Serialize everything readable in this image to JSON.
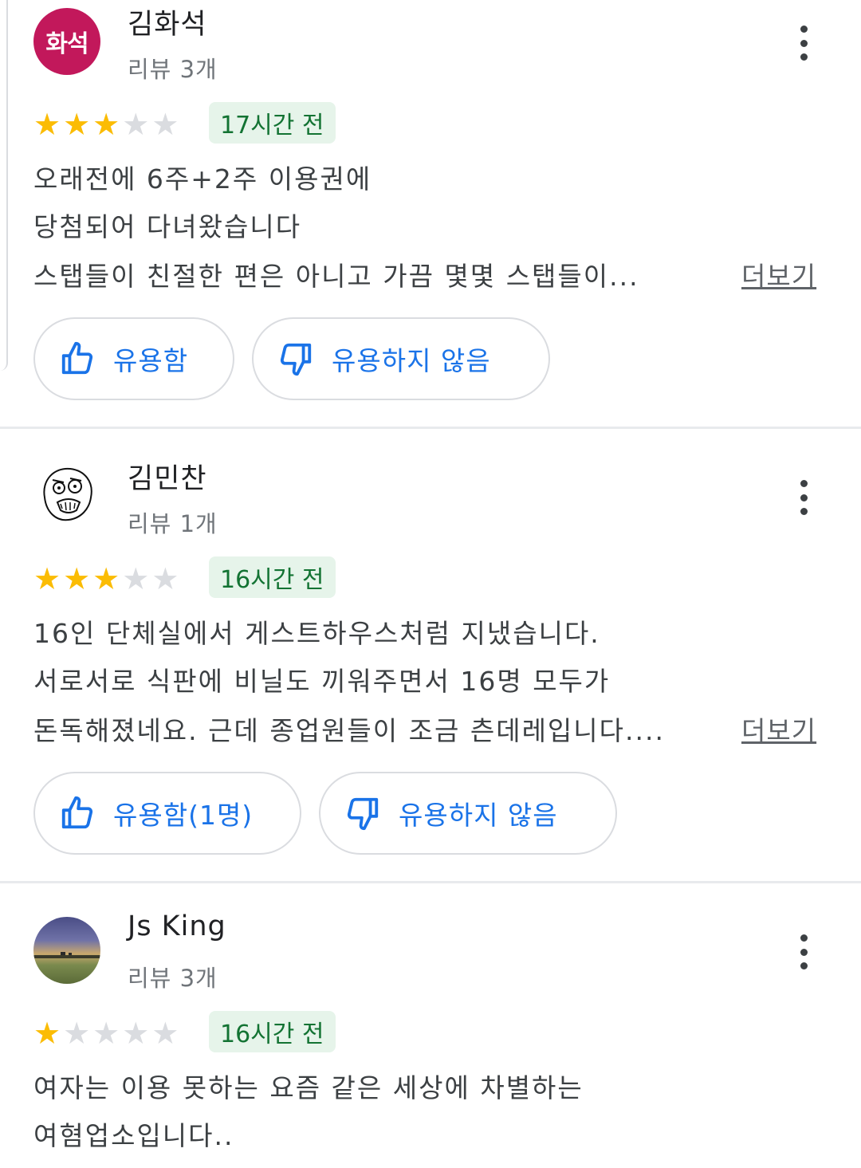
{
  "reviews": [
    {
      "avatar_text": "화석",
      "avatar_color": "#c2185b",
      "name": "김화석",
      "review_count": "리뷰 3개",
      "rating": 3,
      "time": "17시간 전",
      "lines": [
        "오래전에 6주+2주  이용권에",
        "당첨되어 다녀왔습니다",
        "스탭들이 친절한 편은 아니고 가끔 몇몇  스탭들이..."
      ],
      "more_label": "더보기",
      "helpful_label": "유용함",
      "not_helpful_label": "유용하지 않음"
    },
    {
      "avatar_icon": "rage-face-avatar",
      "name": "김민찬",
      "review_count": "리뷰 1개",
      "rating": 3,
      "time": "16시간 전",
      "lines": [
        "16인 단체실에서 게스트하우스처럼 지냈습니다.",
        "서로서로 식판에 비닐도 끼워주면서 16명 모두가",
        "돈독해졌네요. 근데 종업원들이 조금 츤데레입니다...."
      ],
      "more_label": "더보기",
      "helpful_label": "유용함(1명)",
      "not_helpful_label": "유용하지 않음"
    },
    {
      "avatar_icon": "landscape-photo-avatar",
      "name": "Js King",
      "review_count": "리뷰 3개",
      "rating": 1,
      "time": "16시간 전",
      "lines": [
        "여자는 이용 못하는 요즘 같은 세상에 차별하는",
        "여혐업소입니다.."
      ]
    }
  ],
  "colors": {
    "accent": "#1a73e8",
    "star": "#fbbc04",
    "time_badge_bg": "#e6f4ea",
    "time_badge_text": "#137333"
  }
}
